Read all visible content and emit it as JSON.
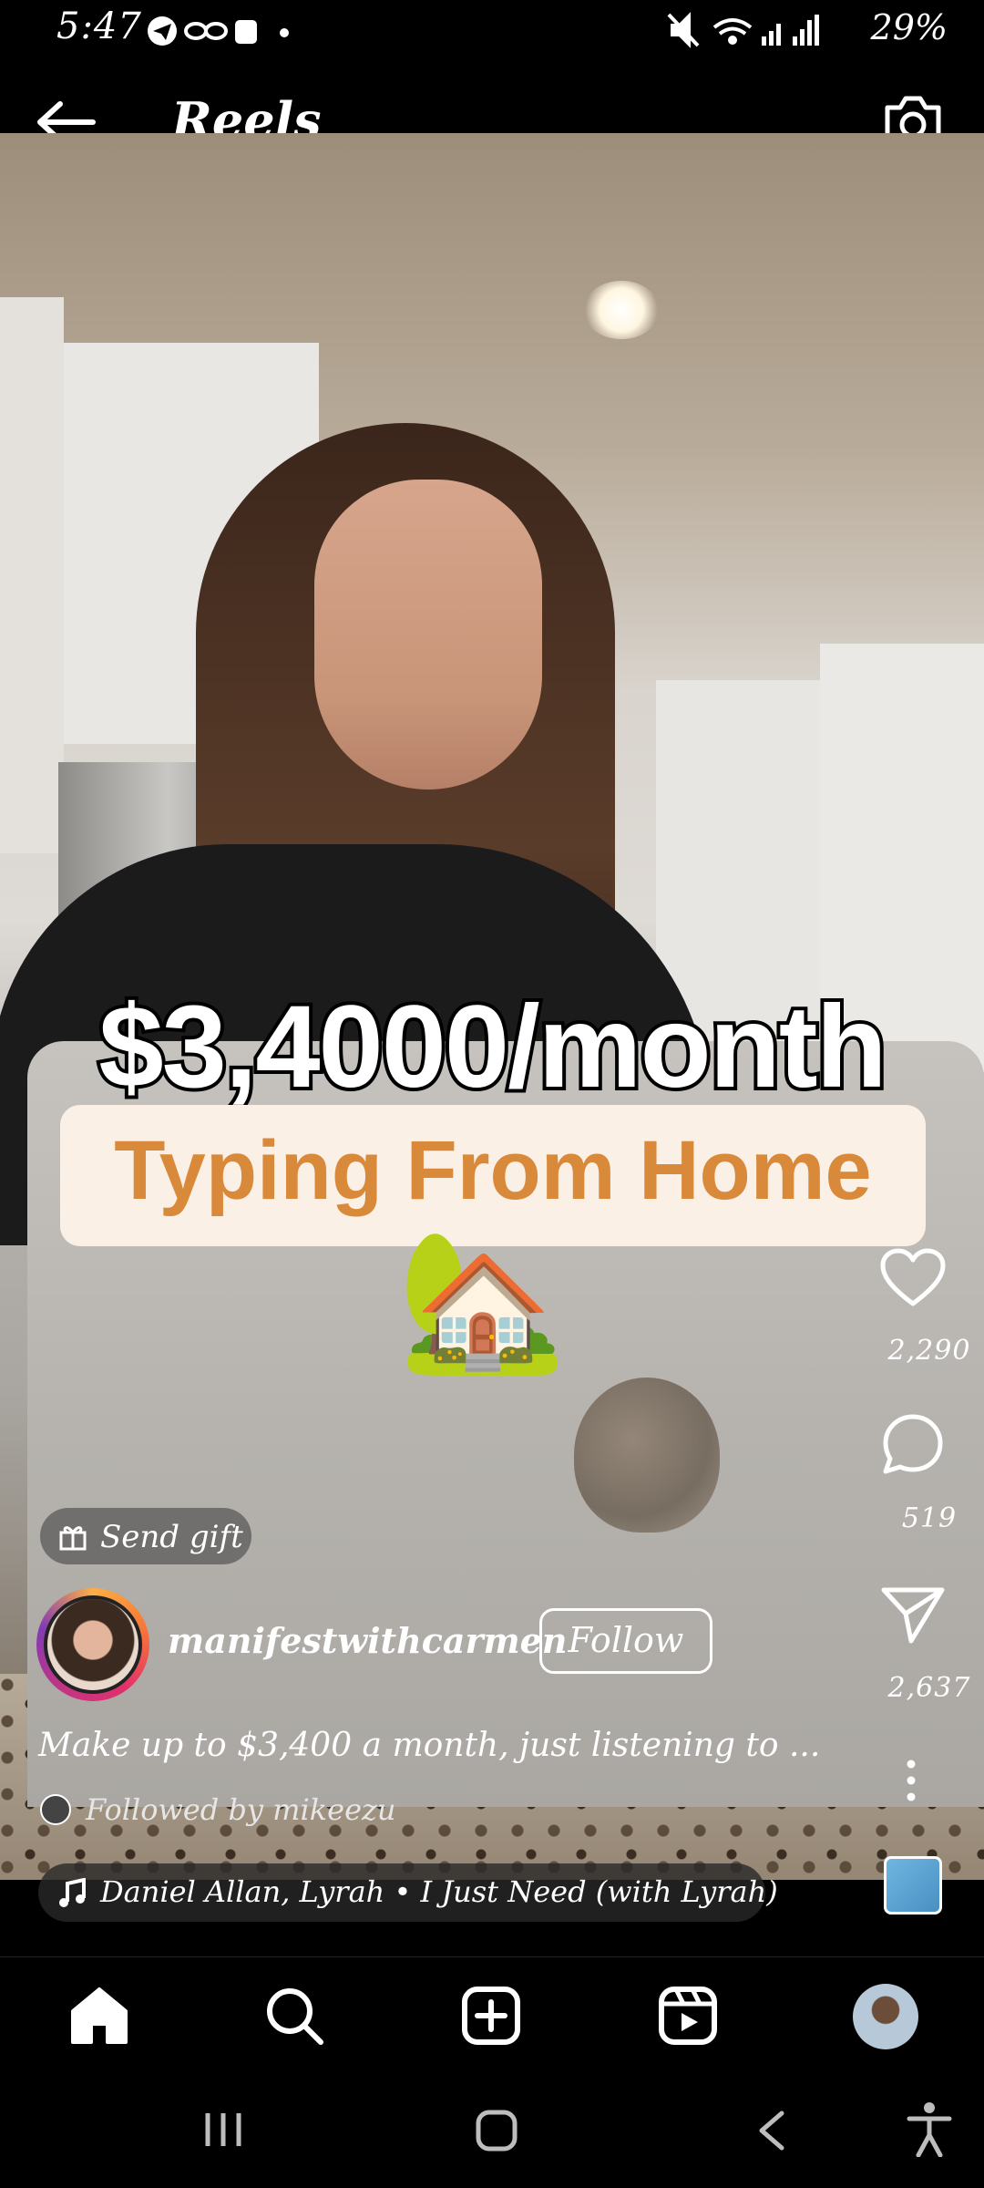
{
  "status_bar": {
    "time": "5:47",
    "battery": "29%",
    "icons": [
      "telegram-icon",
      "infinity-icon",
      "notification-icon",
      "dot-icon",
      "mute-icon",
      "wifi-icon",
      "signal-icon",
      "signal-r-icon",
      "battery-charging-icon"
    ]
  },
  "header": {
    "title": "Reels",
    "back_icon": "arrow-left-icon",
    "camera_icon": "camera-icon"
  },
  "video": {
    "headline": "$3,4000/month",
    "subheadline": "Typing From Home",
    "emoji": "🏡"
  },
  "actions": {
    "likes": "2,290",
    "comments": "519",
    "shares": "2,637"
  },
  "post": {
    "send_gift_label": "Send gift",
    "username": "manifestwithcarmen",
    "follow_label": "Follow",
    "caption": "Make up to $3,400 a month, just listening to ...",
    "followed_by": "Followed by mikeezu",
    "music": "Daniel Allan, Lyrah • I Just Need (with Lyrah)"
  },
  "bottom_nav": {
    "items": [
      "home-icon",
      "search-icon",
      "create-icon",
      "reels-icon",
      "profile-avatar"
    ]
  },
  "system_nav": {
    "items": [
      "recent-apps-icon",
      "home-button-icon",
      "back-button-icon",
      "accessibility-icon"
    ]
  }
}
